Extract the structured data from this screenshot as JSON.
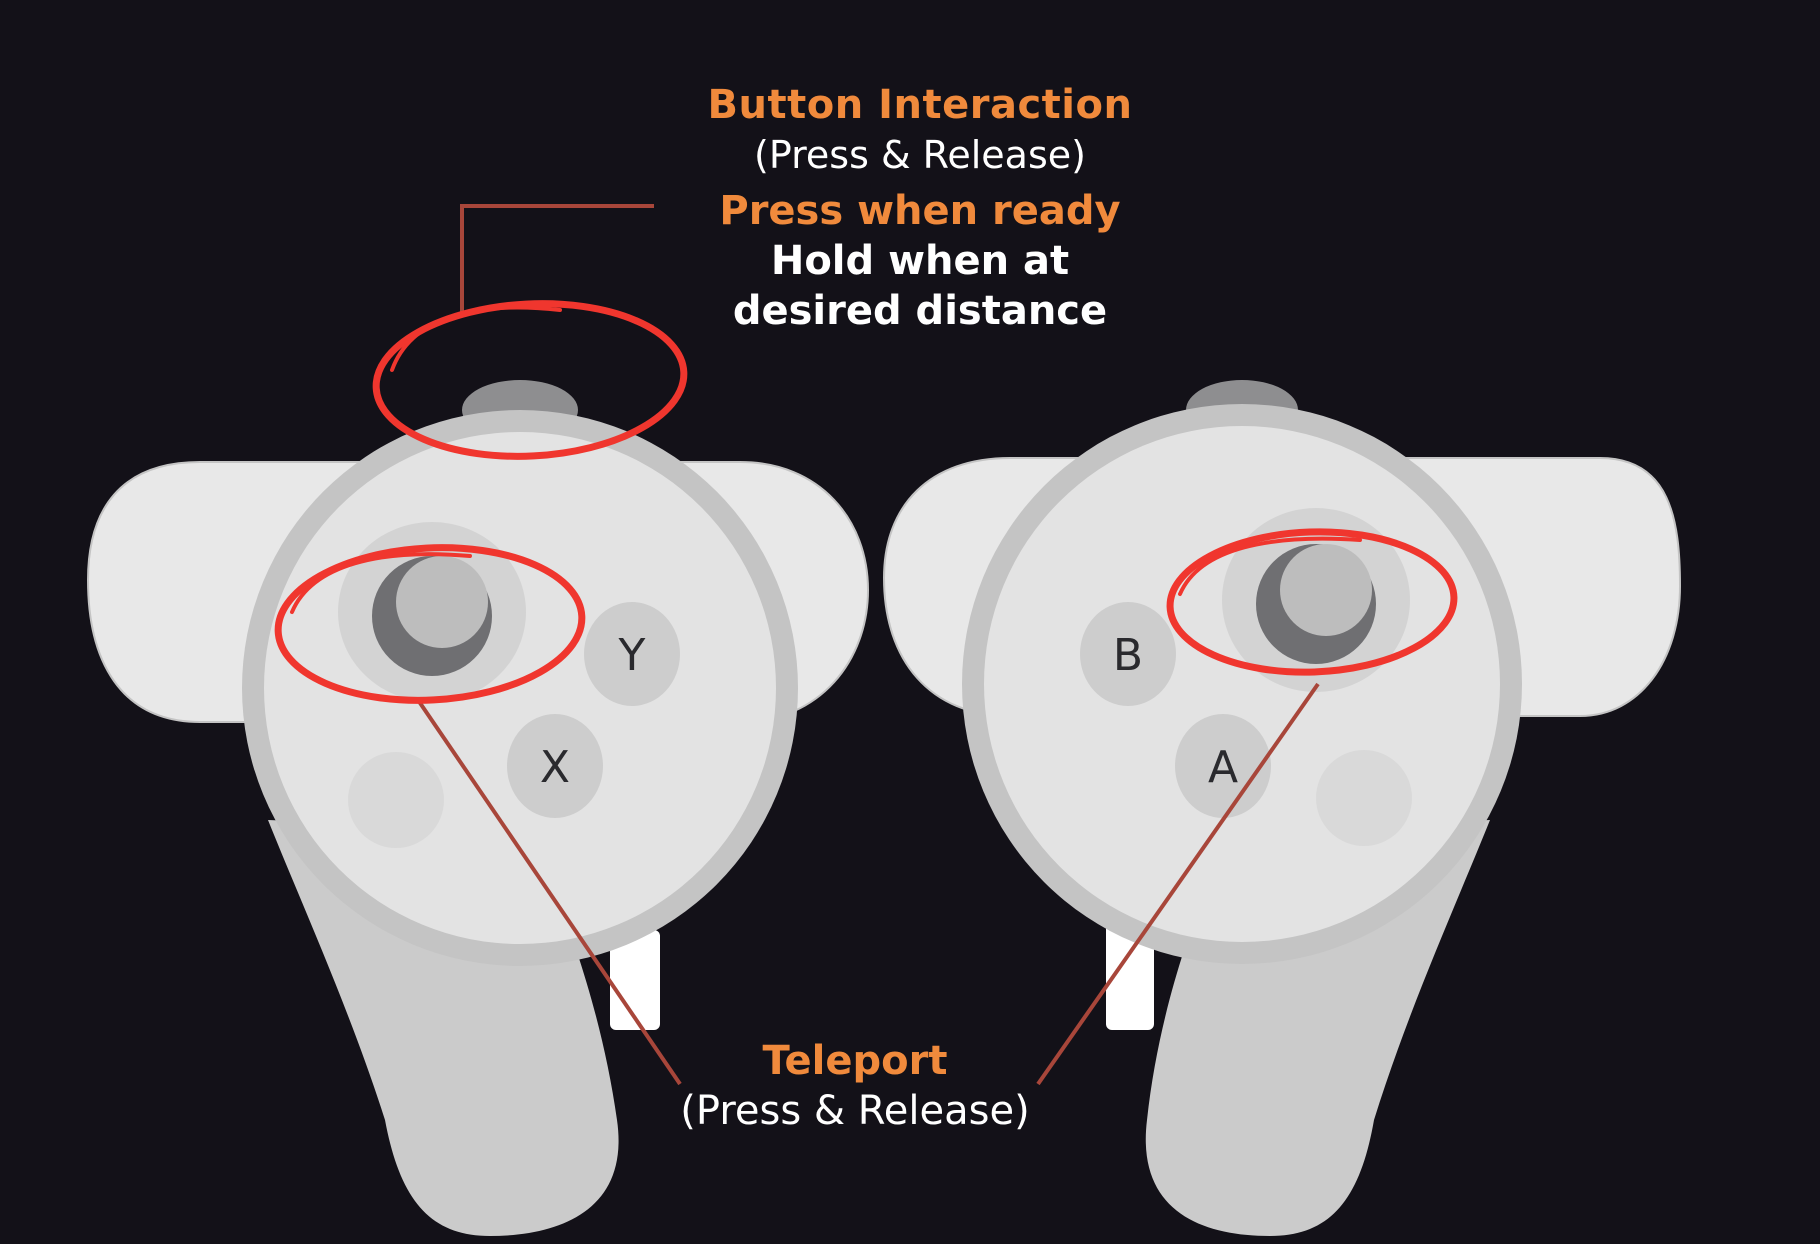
{
  "annotations": {
    "top": {
      "title": "Button Interaction",
      "subtitle": "(Press & Release)",
      "line1": "Press when ready",
      "line2": "Hold when at",
      "line3": "desired distance"
    },
    "bottom": {
      "title": "Teleport",
      "subtitle": "(Press & Release)"
    }
  },
  "controllers": {
    "left": {
      "button_top": "Y",
      "button_bottom": "X"
    },
    "right": {
      "button_top": "B",
      "button_bottom": "A"
    }
  },
  "colors": {
    "background": "#131118",
    "accent_orange": "#f08a3c",
    "highlight_red": "#f0362e",
    "leader_line": "#a8463a",
    "controller_body": "#e3e3e3",
    "controller_ring": "#c4c4c4",
    "thumbstick_dark": "#6f6f72"
  }
}
